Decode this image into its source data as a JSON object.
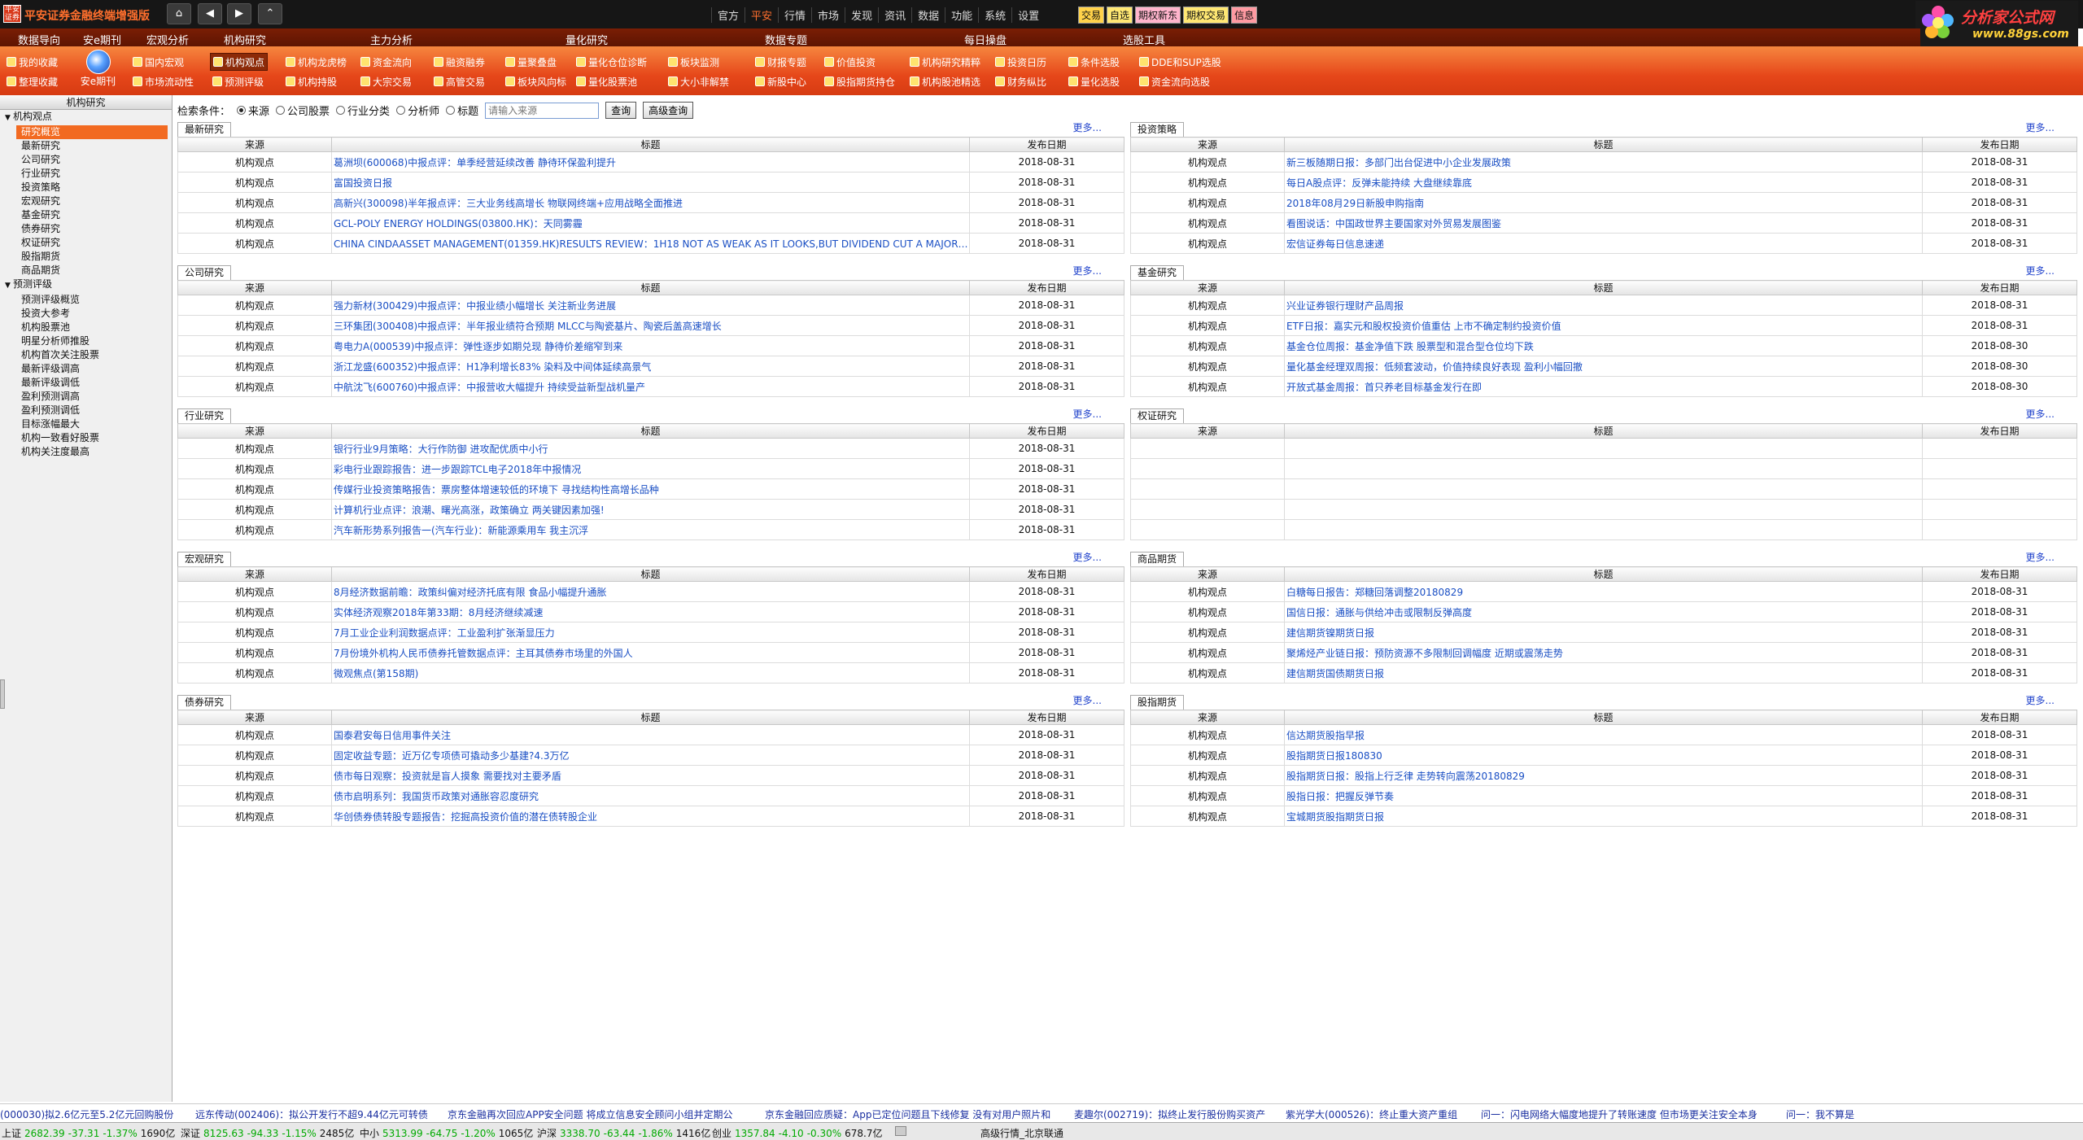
{
  "app": {
    "logo_text": "平安证券",
    "title": "平安证券金融终端增强版"
  },
  "topmenu": [
    "官方",
    "平安",
    "行情",
    "市场",
    "发现",
    "资讯",
    "数据",
    "功能",
    "系统",
    "设置"
  ],
  "topmenu_active": 1,
  "quickbtns": [
    {
      "label": "交易",
      "bg": "#ffd24a"
    },
    {
      "label": "自选",
      "bg": "#ffe873"
    },
    {
      "label": "期权新东",
      "bg": "#ffb4cc"
    },
    {
      "label": "期权交易",
      "bg": "#ffe873"
    },
    {
      "label": "信息",
      "bg": "#ff9aa2"
    }
  ],
  "brand": {
    "name": "分析家公式网",
    "url": "www.88gs.com"
  },
  "categories": [
    "数据导向",
    "安e期刊",
    "宏观分析",
    "机构研究",
    "主力分析",
    "量化研究",
    "数据专题",
    "每日操盘",
    "选股工具"
  ],
  "toolbar": {
    "big": "安e期刊",
    "items": [
      "我的收藏",
      "整理收藏",
      "国内宏观",
      "市场流动性",
      "机构观点",
      "预测评级",
      "机构龙虎榜",
      "机构持股",
      "资金流向",
      "大宗交易",
      "融资融券",
      "高管交易",
      "量聚叠盘",
      "板块风向标",
      "量化仓位诊断",
      "量化股票池",
      "板块监测",
      "大小非解禁",
      "财报专题",
      "新股中心",
      "价值投资",
      "股指期货持仓",
      "机构研究精粹",
      "机构股池精选",
      "投资日历",
      "财务纵比",
      "条件选股",
      "量化选股",
      "DDE和SUP选股",
      "资金流向选股"
    ]
  },
  "sidebar": {
    "title": "机构研究",
    "group1": "机构观点",
    "group1_items": [
      "研究概览",
      "最新研究",
      "公司研究",
      "行业研究",
      "投资策略",
      "宏观研究",
      "基金研究",
      "债券研究",
      "权证研究",
      "股指期货",
      "商品期货"
    ],
    "group2": "预测评级",
    "group2_items": [
      "预测评级概览",
      "投资大参考",
      "机构股票池",
      "明星分析师推股",
      "机构首次关注股票",
      "最新评级调高",
      "最新评级调低",
      "盈利预测调高",
      "盈利预测调低",
      "目标涨幅最大",
      "机构一致看好股票",
      "机构关注度最高"
    ]
  },
  "search": {
    "label": "检索条件：",
    "options": [
      "来源",
      "公司股票",
      "行业分类",
      "分析师",
      "标题"
    ],
    "selected": 0,
    "placeholder": "请输入来源",
    "query_btn": "查询",
    "adv_btn": "高级查询"
  },
  "col_headers": {
    "source": "来源",
    "title": "标题",
    "date": "发布日期"
  },
  "more": "更多...",
  "panels": [
    {
      "name": "最新研究",
      "rows": [
        [
          "机构观点",
          "葛洲坝(600068)中报点评：单季经营延续改善 静待环保盈利提升",
          "2018-08-31"
        ],
        [
          "机构观点",
          "富国投资日报",
          "2018-08-31"
        ],
        [
          "机构观点",
          "高新兴(300098)半年报点评：三大业务线高增长 物联网终端+应用战略全面推进",
          "2018-08-31"
        ],
        [
          "机构观点",
          "GCL-POLY ENERGY HOLDINGS(03800.HK)：天同雾霾",
          "2018-08-31"
        ],
        [
          "机构观点",
          "CHINA CINDAASSET MANAGEMENT(01359.HK)RESULTS REVIEW：1H18 NOT AS WEAK AS IT LOOKS,BUT DIVIDEND CUT A MAJOR OVE...",
          "2018-08-31"
        ]
      ]
    },
    {
      "name": "投资策略",
      "rows": [
        [
          "机构观点",
          "新三板随期日报：多部门出台促进中小企业发展政策",
          "2018-08-31"
        ],
        [
          "机构观点",
          "每日A股点评：反弹未能持续 大盘继续靠底",
          "2018-08-31"
        ],
        [
          "机构观点",
          "2018年08月29日新股申购指南",
          "2018-08-31"
        ],
        [
          "机构观点",
          "看图说话：中国政世界主要国家对外贸易发展图鉴",
          "2018-08-31"
        ],
        [
          "机构观点",
          "宏信证券每日信息速递",
          "2018-08-31"
        ]
      ]
    },
    {
      "name": "公司研究",
      "rows": [
        [
          "机构观点",
          "强力新材(300429)中报点评：中报业绩小幅增长 关注新业务进展",
          "2018-08-31"
        ],
        [
          "机构观点",
          "三环集团(300408)中报点评：半年报业绩符合预期 MLCC与陶瓷基片、陶瓷后盖高速增长",
          "2018-08-31"
        ],
        [
          "机构观点",
          "粤电力A(000539)中报点评：弹性逐步如期兑现 静待价差缩窄到来",
          "2018-08-31"
        ],
        [
          "机构观点",
          "浙江龙盛(600352)中报点评：H1净利增长83% 染料及中间体延续高景气",
          "2018-08-31"
        ],
        [
          "机构观点",
          "中航沈飞(600760)中报点评：中报营收大幅提升 持续受益新型战机量产",
          "2018-08-31"
        ]
      ]
    },
    {
      "name": "基金研究",
      "rows": [
        [
          "机构观点",
          "兴业证券银行理财产品周报",
          "2018-08-31"
        ],
        [
          "机构观点",
          "ETF日报：嘉实元和股权投资价值重估 上市不确定制约投资价值",
          "2018-08-31"
        ],
        [
          "机构观点",
          "基金仓位周报：基金净值下跌 股票型和混合型仓位均下跌",
          "2018-08-30"
        ],
        [
          "机构观点",
          "量化基金经理双周报：低频套波动，价值持续良好表现 盈利小幅回撤",
          "2018-08-30"
        ],
        [
          "机构观点",
          "开放式基金周报：首只养老目标基金发行在即",
          "2018-08-30"
        ]
      ]
    },
    {
      "name": "行业研究",
      "rows": [
        [
          "机构观点",
          "银行行业9月策略：大行作防御 进攻配优质中小行",
          "2018-08-31"
        ],
        [
          "机构观点",
          "彩电行业跟踪报告：进一步跟踪TCL电子2018年中报情况",
          "2018-08-31"
        ],
        [
          "机构观点",
          "传媒行业投资策略报告：票房整体增速较低的环境下 寻找结构性高增长品种",
          "2018-08-31"
        ],
        [
          "机构观点",
          "计算机行业点评：浪潮、曙光高涨，政策确立 两关键因素加强!",
          "2018-08-31"
        ],
        [
          "机构观点",
          "汽车新形势系列报告一(汽车行业)：新能源乘用车 我主沉浮",
          "2018-08-31"
        ]
      ]
    },
    {
      "name": "权证研究",
      "rows": [
        [
          "",
          "",
          ""
        ],
        [
          "",
          "",
          ""
        ],
        [
          "",
          "",
          ""
        ],
        [
          "",
          "",
          ""
        ],
        [
          "",
          "",
          ""
        ]
      ]
    },
    {
      "name": "宏观研究",
      "rows": [
        [
          "机构观点",
          "8月经济数据前瞻：政策纠偏对经济托底有限 食品小幅提升通胀",
          "2018-08-31"
        ],
        [
          "机构观点",
          "实体经济观察2018年第33期：8月经济继续减速",
          "2018-08-31"
        ],
        [
          "机构观点",
          "7月工业企业利润数据点评：工业盈利扩张渐显压力",
          "2018-08-31"
        ],
        [
          "机构观点",
          "7月份境外机构人民币债券托管数据点评：主耳其债券市场里的外国人",
          "2018-08-31"
        ],
        [
          "机构观点",
          "微观焦点(第158期)",
          "2018-08-31"
        ]
      ]
    },
    {
      "name": "商品期货",
      "rows": [
        [
          "机构观点",
          "白糖每日报告：郑糖回落调整20180829",
          "2018-08-31"
        ],
        [
          "机构观点",
          "国信日报：通胀与供给冲击或限制反弹高度",
          "2018-08-31"
        ],
        [
          "机构观点",
          "建信期货镍期货日报",
          "2018-08-31"
        ],
        [
          "机构观点",
          "聚烯烃产业链日报：预防资源不多限制回调幅度 近期或震荡走势",
          "2018-08-31"
        ],
        [
          "机构观点",
          "建信期货国债期货日报",
          "2018-08-31"
        ]
      ]
    },
    {
      "name": "债券研究",
      "rows": [
        [
          "机构观点",
          "国泰君安每日信用事件关注",
          "2018-08-31"
        ],
        [
          "机构观点",
          "固定收益专题：近万亿专项债可撬动多少基建?4.3万亿",
          "2018-08-31"
        ],
        [
          "机构观点",
          "债市每日观察：投资就是盲人摸象 需要找对主要矛盾",
          "2018-08-31"
        ],
        [
          "机构观点",
          "债市启明系列：我国货币政策对通胀容忍度研究",
          "2018-08-31"
        ],
        [
          "机构观点",
          "华创债券债转股专题报告：挖掘高投资价值的潜在债转股企业",
          "2018-08-31"
        ]
      ]
    },
    {
      "name": "股指期货",
      "rows": [
        [
          "机构观点",
          "信达期货股指早报",
          "2018-08-31"
        ],
        [
          "机构观点",
          "股指期货日报180830",
          "2018-08-31"
        ],
        [
          "机构观点",
          "股指期货日报：股指上行乏律 走势转向震荡20180829",
          "2018-08-31"
        ],
        [
          "机构观点",
          "股指日报：把握反弹节奏",
          "2018-08-31"
        ],
        [
          "机构观点",
          "宝城期货股指期货日报",
          "2018-08-31"
        ]
      ]
    }
  ],
  "ticker": [
    "(000030)拟2.6亿元至5.2亿元回购股份",
    "远东传动(002406)：拟公开发行不超9.44亿元可转债",
    "京东金融再次回应APP安全问题 将成立信息安全顾问小组并定期公",
    "京东金融回应质疑：App已定位问题且下线修复 没有对用户照片和",
    "麦趣尔(002719)：拟终止发行股份购买资产",
    "紫光学大(000526)：终止重大资产重组",
    "闪电网络大幅度地提升了转账速度 但市场更关注安全本身",
    "我不算是"
  ],
  "ticker_prefix": [
    "",
    "",
    "",
    "",
    "",
    "",
    "问一：",
    "问一："
  ],
  "status": [
    {
      "name": "上证",
      "val": "2682.39",
      "chg": "-37.31",
      "pct": "-1.37%",
      "amt": "1690亿"
    },
    {
      "name": "深证",
      "val": "8125.63",
      "chg": "-94.33",
      "pct": "-1.15%",
      "amt": "2485亿"
    },
    {
      "name": "中小",
      "val": "5313.99",
      "chg": "-64.75",
      "pct": "-1.20%",
      "amt": "1065亿"
    },
    {
      "name": "沪深",
      "val": "3338.70",
      "chg": "-63.44",
      "pct": "-1.86%",
      "amt": "1416亿"
    },
    {
      "name": "创业",
      "val": "1357.84",
      "chg": "-4.10",
      "pct": "-0.30%",
      "amt": "678.7亿"
    }
  ],
  "status_right": "高级行情_北京联通"
}
